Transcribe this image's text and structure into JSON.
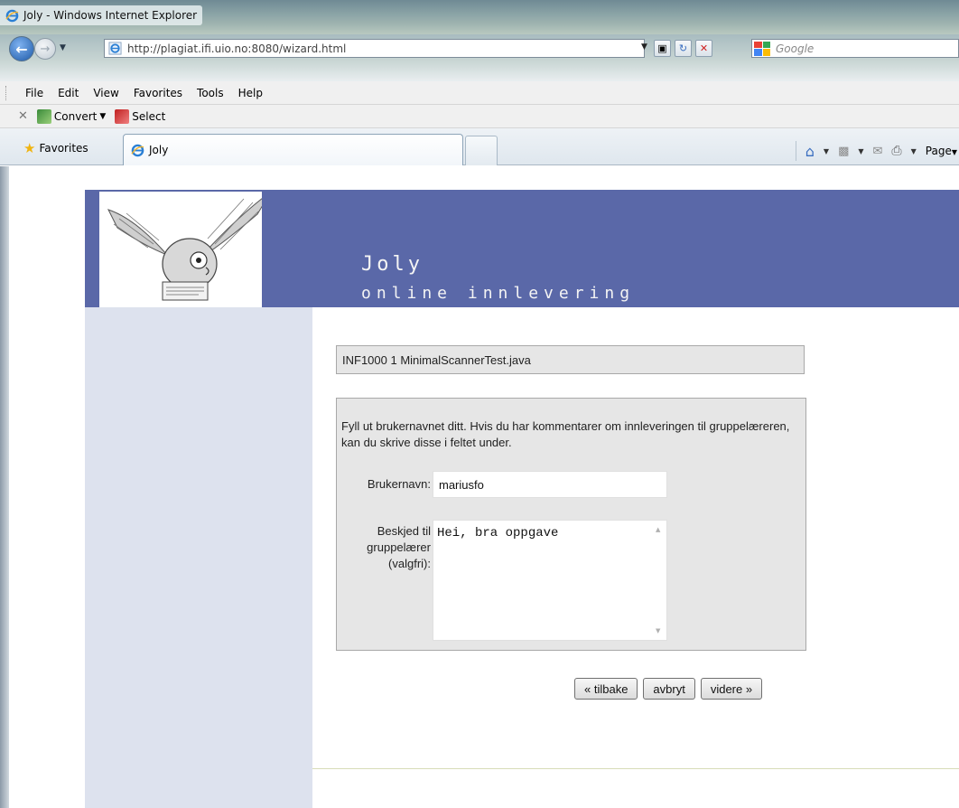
{
  "window": {
    "title": "Joly - Windows Internet Explorer"
  },
  "address_bar": {
    "url": "http://plagiat.ifi.uio.no:8080/wizard.html",
    "search_placeholder": "Google"
  },
  "menu": {
    "items": [
      "File",
      "Edit",
      "View",
      "Favorites",
      "Tools",
      "Help"
    ]
  },
  "convert_toolbar": {
    "convert_label": "Convert",
    "select_label": "Select"
  },
  "favorites_bar": {
    "favorites_label": "Favorites",
    "tab_title": "Joly",
    "page_menu": "Page"
  },
  "page": {
    "app_title": "Joly",
    "app_subtitle": "online innlevering",
    "file_info": "INF1000 1 MinimalScannerTest.java",
    "instructions": "Fyll ut brukernavnet ditt. Hvis du har kommentarer om innleveringen til gruppelæreren, kan du skrive disse i feltet under.",
    "username_label": "Brukernavn:",
    "username_value": "mariusfo",
    "message_label_1": "Beskjed til",
    "message_label_2": "gruppelærer",
    "message_label_3": "(valgfri):",
    "message_value": "Hei, bra oppgave",
    "buttons": {
      "back": "« tilbake",
      "cancel": "avbryt",
      "next": "videre »"
    }
  }
}
